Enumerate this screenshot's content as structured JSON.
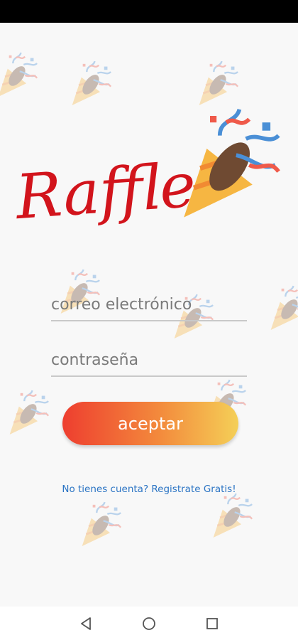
{
  "app": {
    "logo_text": "Raffle!"
  },
  "login": {
    "email_placeholder": "correo electrónico",
    "password_placeholder": "contraseña",
    "accept_label": "aceptar",
    "register_text": "No tienes cuenta? Registrate Gratis!"
  },
  "colors": {
    "logo_red": "#d2141c",
    "button_gradient_start": "#ee3e2f",
    "button_gradient_end": "#f4cf57",
    "link_blue": "#2b74c4"
  },
  "icons": {
    "background": "party-popper-icon",
    "logo": "party-popper-icon",
    "nav_back": "triangle-back-icon",
    "nav_home": "circle-home-icon",
    "nav_recents": "square-recents-icon"
  }
}
